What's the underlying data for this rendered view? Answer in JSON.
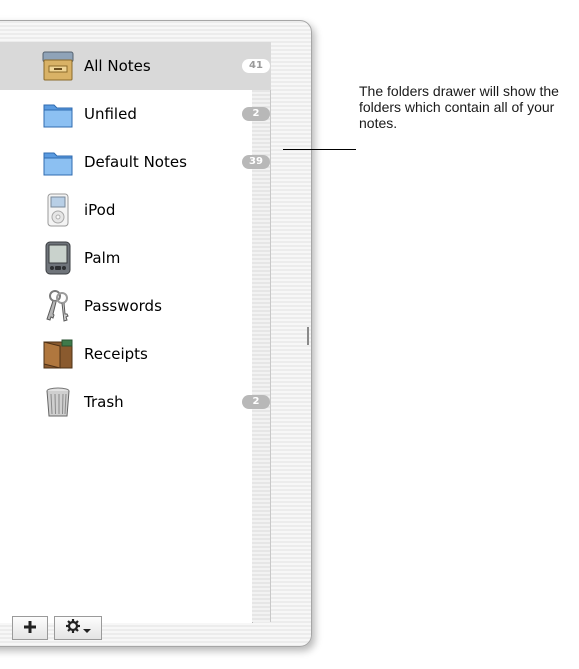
{
  "folders": [
    {
      "label": "All Notes",
      "count": "41",
      "icon": "file-cabinet-icon",
      "selected": true
    },
    {
      "label": "Unfiled",
      "count": "2",
      "icon": "folder-icon"
    },
    {
      "label": "Default Notes",
      "count": "39",
      "icon": "folder-icon"
    },
    {
      "label": "iPod",
      "count": "",
      "icon": "ipod-icon"
    },
    {
      "label": "Palm",
      "count": "",
      "icon": "palm-icon"
    },
    {
      "label": "Passwords",
      "count": "",
      "icon": "keys-icon"
    },
    {
      "label": "Receipts",
      "count": "",
      "icon": "wallet-icon"
    },
    {
      "label": "Trash",
      "count": "2",
      "icon": "trash-icon"
    }
  ],
  "toolbar": {
    "add_icon": "plus-icon",
    "action_icon": "gear-icon"
  },
  "callout": {
    "text": "The folders drawer will show the folders which contain all of your notes."
  },
  "colors": {
    "selection": "#d9d9d9",
    "badge": "#b8b8b8",
    "folder_blue": "#6aa8e8"
  }
}
